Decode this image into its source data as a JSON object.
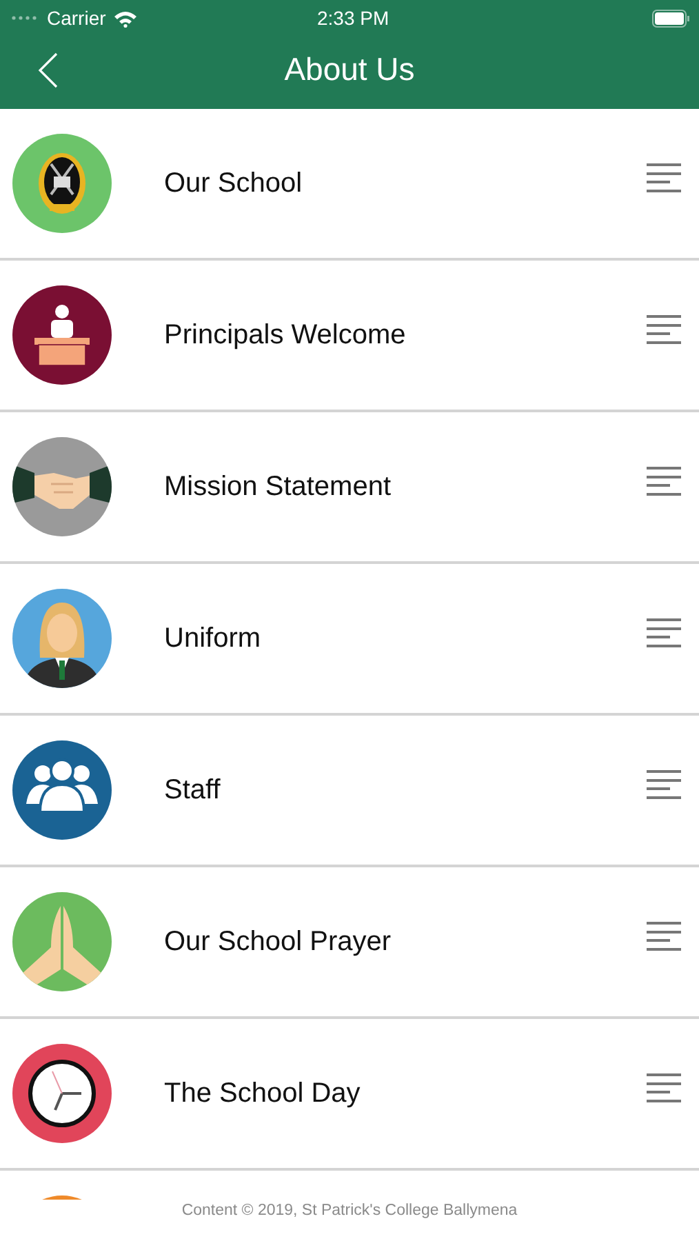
{
  "status_bar": {
    "carrier": "Carrier",
    "time": "2:33 PM"
  },
  "nav": {
    "title": "About Us"
  },
  "items": [
    {
      "kind": "crest",
      "label": "Our School"
    },
    {
      "kind": "podium",
      "label": "Principals Welcome"
    },
    {
      "kind": "handshake",
      "label": "Mission Statement"
    },
    {
      "kind": "person",
      "label": "Uniform"
    },
    {
      "kind": "group",
      "label": "Staff"
    },
    {
      "kind": "hands",
      "label": "Our School Prayer"
    },
    {
      "kind": "clock",
      "label": "The School Day"
    },
    {
      "kind": "orange"
    }
  ],
  "footer": "Content © 2019, St Patrick's College Ballymena"
}
